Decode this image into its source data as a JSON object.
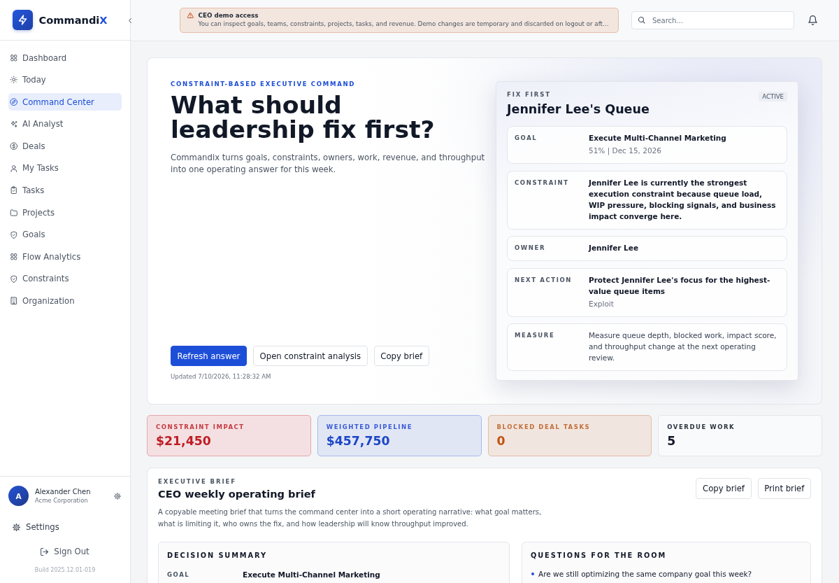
{
  "sidebar": {
    "brand": {
      "name": "Commandi",
      "accent": "X"
    },
    "nav": [
      {
        "label": "Dashboard",
        "selected": false
      },
      {
        "label": "Today",
        "selected": false
      },
      {
        "label": "Command Center",
        "selected": true
      },
      {
        "label": "AI Analyst",
        "selected": false
      },
      {
        "label": "Deals",
        "selected": false
      },
      {
        "label": "My Tasks",
        "selected": false
      },
      {
        "label": "Tasks",
        "selected": false
      },
      {
        "label": "Projects",
        "selected": false
      },
      {
        "label": "Goals",
        "selected": false
      },
      {
        "label": "Flow Analytics",
        "selected": false
      },
      {
        "label": "Constraints",
        "selected": false
      },
      {
        "label": "Organization",
        "selected": false
      }
    ],
    "user": {
      "initial": "A",
      "name": "Alexander Chen",
      "org": "Acme Corporation"
    },
    "settings": "Settings",
    "sign_out": "Sign Out",
    "build": "Build 2025.12.01-019"
  },
  "topbar": {
    "notice": {
      "title": "CEO demo access",
      "text": "You can inspect goals, teams, constraints, projects, tasks, and revenue. Demo changes are temporary and discarded on logout or aft…"
    },
    "search": {
      "placeholder": "Search..."
    }
  },
  "hero": {
    "eyebrow": "CONSTRAINT-BASED EXECUTIVE COMMAND",
    "title": "What should leadership fix first?",
    "description": "Commandix turns goals, constraints, owners, work, revenue, and throughput into one operating answer for this week.",
    "actions": [
      {
        "label": "Refresh answer",
        "kind": "primary"
      },
      {
        "label": "Open constraint analysis",
        "kind": "secondary"
      },
      {
        "label": "Copy brief",
        "kind": "secondary"
      }
    ],
    "updated": "Updated 7/10/2026, 11:28:32 AM",
    "queue": {
      "eyebrow": "FIX FIRST",
      "badge": "ACTIVE",
      "title": "Jennifer Lee's Queue",
      "rows": [
        {
          "label": "GOAL",
          "value": "Execute Multi-Channel Marketing",
          "detail": "51% | Dec 15, 2026",
          "kind": "strong"
        },
        {
          "label": "CONSTRAINT",
          "value": "Jennifer Lee is currently the strongest execution constraint because queue load, WIP pressure, blocking signals, and business impact converge here.",
          "kind": "strong"
        },
        {
          "label": "OWNER",
          "value": "Jennifer Lee",
          "kind": "strong"
        },
        {
          "label": "NEXT ACTION",
          "value": "Protect Jennifer Lee's focus for the highest-value queue items",
          "detail": "Exploit",
          "kind": "strong"
        },
        {
          "label": "MEASURE",
          "value": "Measure queue depth, blocked work, impact score, and throughput change at the next operating review.",
          "kind": "plain"
        }
      ]
    }
  },
  "stats": [
    {
      "label": "CONSTRAINT IMPACT",
      "value": "$21,450",
      "kind": "danger"
    },
    {
      "label": "WEIGHTED PIPELINE",
      "value": "$457,750",
      "kind": "info"
    },
    {
      "label": "BLOCKED DEAL TASKS",
      "value": "0",
      "kind": "warning"
    },
    {
      "label": "OVERDUE WORK",
      "value": "5",
      "kind": "neutral"
    }
  ],
  "brief": {
    "eyebrow": "EXECUTIVE BRIEF",
    "title": "CEO weekly operating brief",
    "description": "A copyable meeting brief that turns the command center into a short operating narrative: what goal matters, what is limiting it, who owns the fix, and how leadership will know throughput improved.",
    "actions": [
      "Copy brief",
      "Print brief"
    ],
    "decision_summary": {
      "title": "DECISION SUMMARY",
      "rows": [
        {
          "label": "GOAL",
          "value": "Execute Multi-Channel Marketing"
        }
      ]
    },
    "questions": {
      "title": "QUESTIONS FOR THE ROOM",
      "items": [
        "Are we still optimizing the same company goal this week?"
      ]
    }
  }
}
